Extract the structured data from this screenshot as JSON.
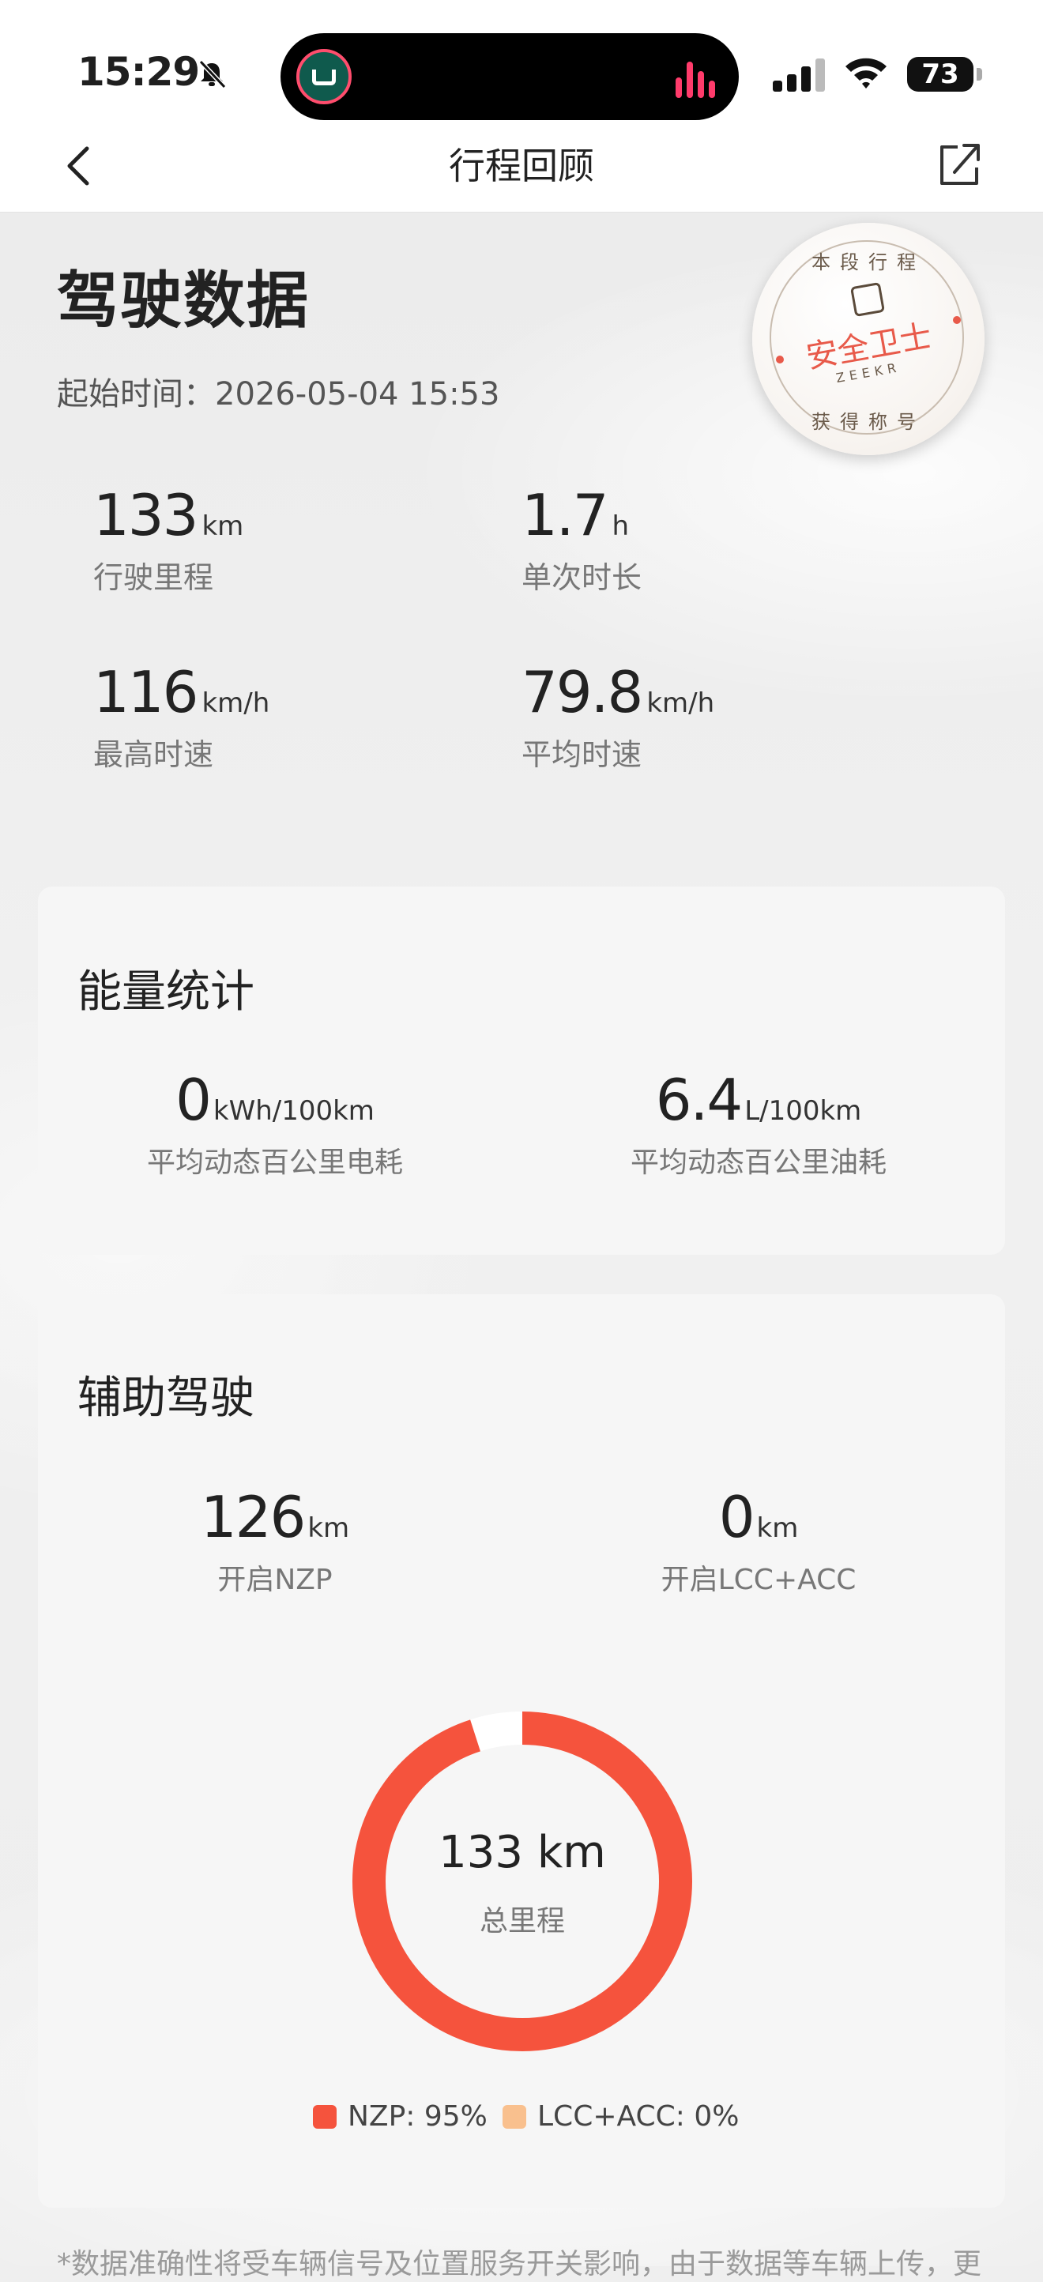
{
  "status_bar": {
    "time": "15:29",
    "battery": "73"
  },
  "nav": {
    "title": "行程回顾"
  },
  "header": {
    "title": "驾驶数据",
    "start_label": "起始时间：",
    "start_value": "2026-05-04 15:53",
    "badge": {
      "top": "本段行程",
      "main": "安全卫士",
      "brand": "ZEEKR",
      "bottom": "获得称号"
    }
  },
  "stats": [
    {
      "value": "133",
      "unit": "km",
      "label": "行驶里程"
    },
    {
      "value": "1.7",
      "unit": "h",
      "label": "单次时长"
    },
    {
      "value": "116",
      "unit": "km/h",
      "label": "最高时速"
    },
    {
      "value": "79.8",
      "unit": "km/h",
      "label": "平均时速"
    }
  ],
  "energy": {
    "title": "能量统计",
    "items": [
      {
        "value": "0",
        "unit": "kWh/100km",
        "label": "平均动态百公里电耗"
      },
      {
        "value": "6.4",
        "unit": "L/100km",
        "label": "平均动态百公里油耗"
      }
    ]
  },
  "assist": {
    "title": "辅助驾驶",
    "items": [
      {
        "value": "126",
        "unit": "km",
        "label": "开启NZP"
      },
      {
        "value": "0",
        "unit": "km",
        "label": "开启LCC+ACC"
      }
    ],
    "donut": {
      "center_value": "133 km",
      "center_label": "总里程",
      "segments": [
        {
          "name": "NZP",
          "percent": 95,
          "color": "#f5533d",
          "legend": "NZP: 95%"
        },
        {
          "name": "LCC+ACC",
          "percent": 0,
          "color": "#f9c08e",
          "legend": "LCC+ACC: 0%"
        }
      ],
      "remainder_color": "#ffffff"
    }
  },
  "footnote": "*数据准确性将受车辆信号及位置服务开关影响，由于数据等车辆上传，更"
}
